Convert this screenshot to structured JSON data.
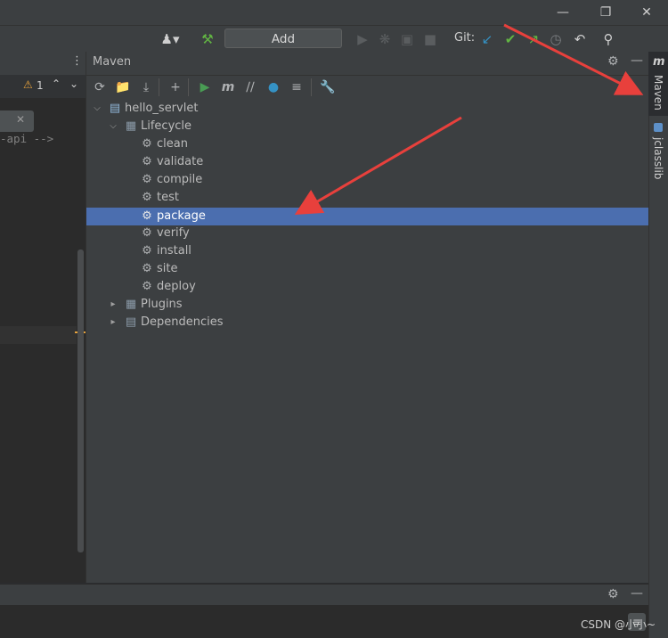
{
  "toolbar": {
    "add_configuration_label": "Add Configuration...",
    "git_label": "Git:"
  },
  "editor": {
    "warning_count": "1",
    "code_fragment": "-api -->"
  },
  "maven_panel": {
    "title": "Maven",
    "project": "hello_servlet",
    "lifecycle_label": "Lifecycle",
    "lifecycle_items": [
      "clean",
      "validate",
      "compile",
      "test",
      "package",
      "verify",
      "install",
      "site",
      "deploy"
    ],
    "selected_item": "package",
    "plugins_label": "Plugins",
    "dependencies_label": "Dependencies"
  },
  "right_strip": {
    "maven_tab": "Maven",
    "jclasslib_tab": "jclasslib"
  },
  "watermark": "CSDN @小小~",
  "colors": {
    "selection": "#4b6eaf",
    "annotation_arrow": "#e8403c",
    "run_green": "#499c54"
  }
}
